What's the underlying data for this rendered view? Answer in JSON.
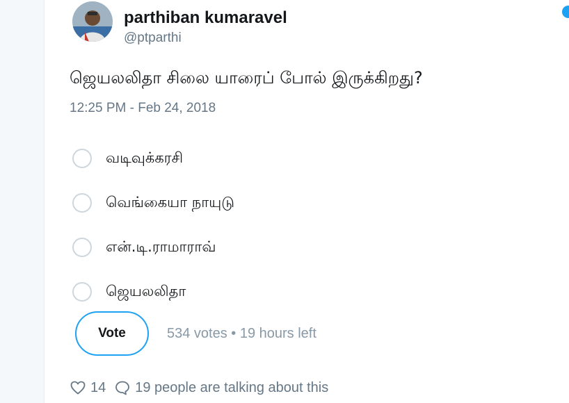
{
  "tweet": {
    "author_name": "parthiban kumaravel",
    "author_handle": "@ptparthi",
    "text": "ஜெயலலிதா சிலை யாரைப் போல் இருக்கிறது?",
    "timestamp": "12:25 PM - Feb 24, 2018"
  },
  "poll": {
    "options": [
      {
        "label": "வடிவுக்கரசி"
      },
      {
        "label": "வெங்கையா நாயுடு"
      },
      {
        "label": "என்.டி.ராமாராவ்"
      },
      {
        "label": "ஜெயலலிதா"
      }
    ],
    "vote_button_label": "Vote",
    "meta": "534 votes • 19 hours left"
  },
  "footer": {
    "like_count": "14",
    "talking_text": "19 people are talking about this"
  },
  "icons": {
    "like": "heart-icon",
    "reply": "speech-bubble-icon"
  },
  "colors": {
    "accent": "#1da1f2",
    "secondary_text": "#657786",
    "muted_text": "#8899a6",
    "radio_border": "#ccd6dd"
  }
}
